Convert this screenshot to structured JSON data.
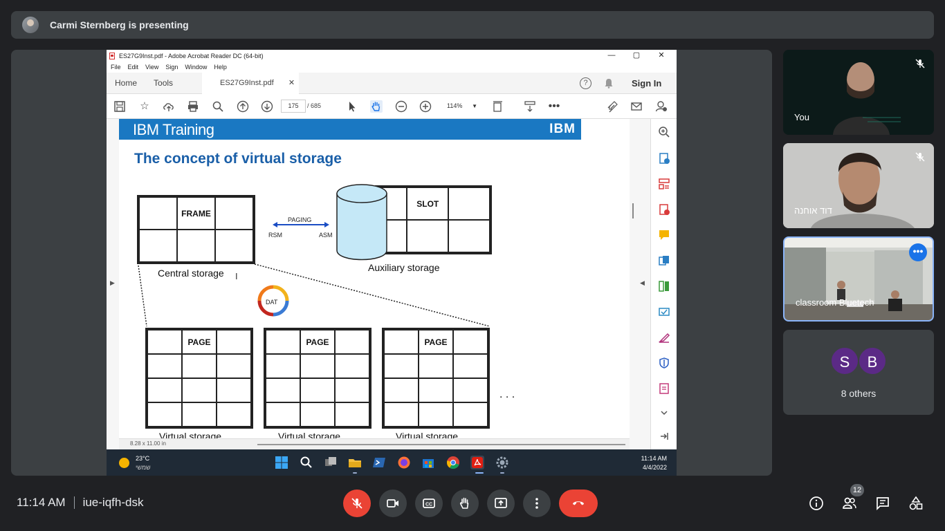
{
  "meeting": {
    "presenting_text": "Carmi Sternberg is presenting",
    "time": "11:14 AM",
    "meeting_code": "iue-iqfh-dsk",
    "participant_badge": "12"
  },
  "acrobat": {
    "title": "ES27G9Inst.pdf - Adobe Acrobat Reader DC (64-bit)",
    "menu": [
      "File",
      "Edit",
      "View",
      "Sign",
      "Window",
      "Help"
    ],
    "tab_home": "Home",
    "tab_tools": "Tools",
    "doc_tab": "ES27G9Inst.pdf",
    "sign_in": "Sign In",
    "page_current": "175",
    "page_total": "/ 685",
    "zoom": "114%",
    "page_dims": "8.28 x 11.00 in"
  },
  "slide": {
    "band_title": "IBM Training",
    "logo": "IBM",
    "title": "The concept of virtual storage",
    "frame_label": "FRAME",
    "slot_label": "SLOT",
    "paging_label": "PAGING",
    "rsm_label": "RSM",
    "asm_label": "ASM",
    "central_caption": "Central storage",
    "aux_caption": "Auxiliary storage",
    "dat_label": "DAT",
    "page_label": "PAGE",
    "virtual_caption": "Virtual storage",
    "ellipsis": ". . ."
  },
  "taskbar": {
    "temp": "23°C",
    "weather_desc": "שמשי",
    "clock_time": "11:14 AM",
    "clock_date": "4/4/2022"
  },
  "participants": {
    "you": "You",
    "david": "דוד אוחנה",
    "classroom": "classroom Bluetech",
    "others_initials": [
      "S",
      "B"
    ],
    "others_count": "8 others"
  }
}
